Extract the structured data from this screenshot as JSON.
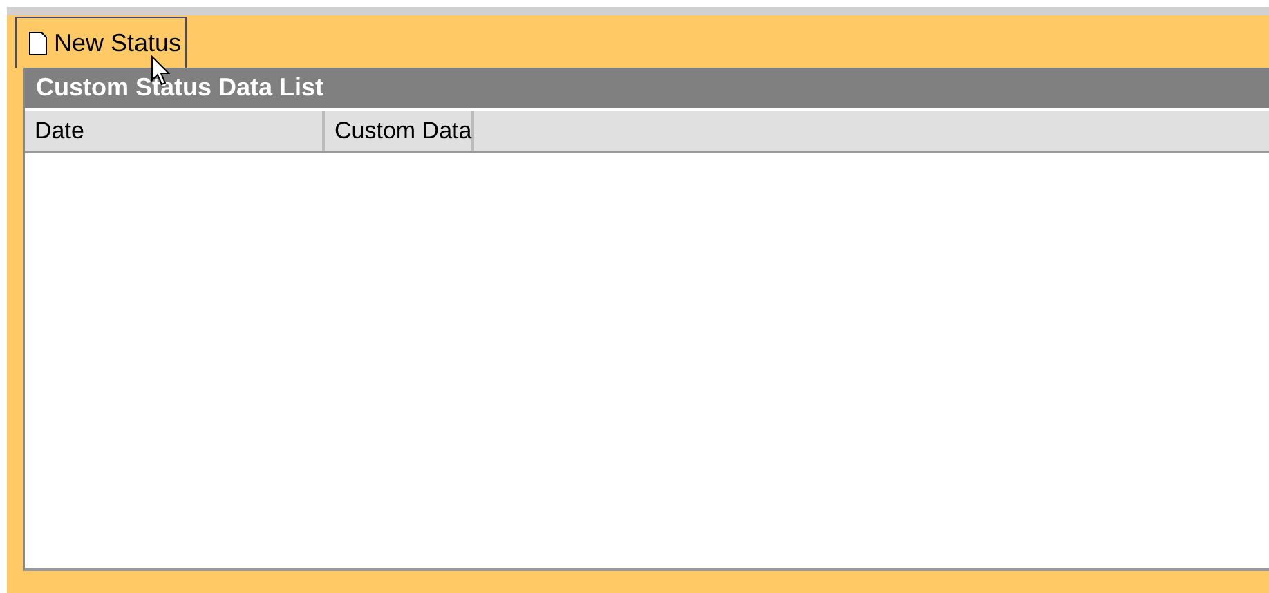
{
  "toolbar": {
    "new_button": {
      "label": "New Status"
    }
  },
  "panel": {
    "title": "Custom Status Data List",
    "table": {
      "columns": [
        "Date",
        "Custom Data"
      ]
    }
  }
}
